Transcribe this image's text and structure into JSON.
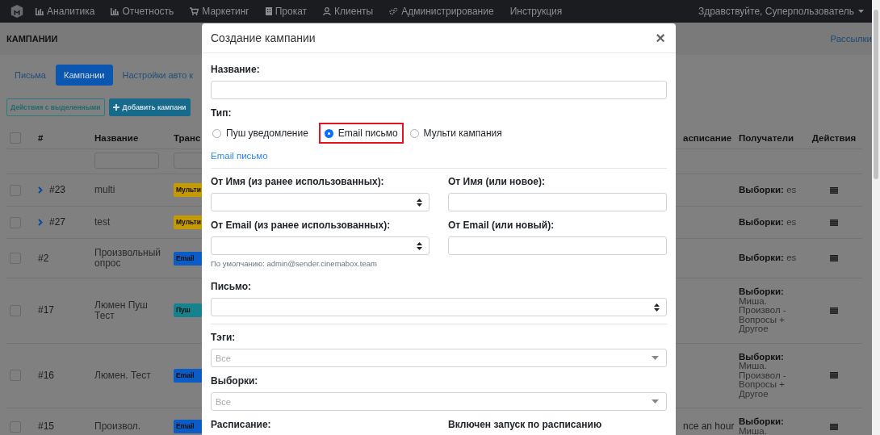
{
  "navbar": {
    "items": [
      {
        "label": "Аналитика"
      },
      {
        "label": "Отчетность"
      },
      {
        "label": "Маркетинг"
      },
      {
        "label": "Прокат"
      },
      {
        "label": "Клиенты"
      },
      {
        "label": "Администрирование"
      },
      {
        "label": "Инструкция"
      }
    ],
    "greeting": "Здравствуйте, Суперпользователь"
  },
  "page_header": {
    "title": "КАМПАНИИ",
    "link": "Рассылки"
  },
  "tabs": [
    {
      "label": "Письма",
      "selected": false
    },
    {
      "label": "Кампании",
      "selected": true
    },
    {
      "label": "Настройки авто к",
      "selected": false
    }
  ],
  "toolbar": {
    "bulk_button": "Действия с выделенными",
    "add_button": "Добавить кампани"
  },
  "table": {
    "header_checked": false,
    "columns": [
      "#",
      "Название",
      "Транс",
      "асписание",
      "Получатели",
      "Действия"
    ],
    "rows": [
      {
        "checked": false,
        "expandable": true,
        "number": "#23",
        "name": "multi",
        "badge": {
          "label": "Мульти",
          "color": "#c49a00"
        },
        "recipients": "**Выборки:** es"
      },
      {
        "checked": false,
        "expandable": true,
        "number": "#27",
        "name": "test",
        "badge": {
          "label": "Мульти",
          "color": "#c49a00"
        },
        "recipients": "**Выборки:** es"
      },
      {
        "checked": false,
        "expandable": false,
        "number": "#2",
        "name": "Произвольный опрос",
        "badge": {
          "label": "Email",
          "color": "#0b5cc4"
        },
        "recipients": "**Выборки:** es"
      },
      {
        "checked": false,
        "expandable": false,
        "number": "#17",
        "name": "Люмен Пуш Тест",
        "badge": {
          "label": "Пуш",
          "color": "#14838e"
        },
        "recipients": "**Выборки:** Миша. Произвол - Вопросы + Другое"
      },
      {
        "checked": false,
        "expandable": false,
        "number": "#16",
        "name": "Люмен. Тест",
        "badge": {
          "label": "Email",
          "color": "#0b5cc4"
        },
        "recipients": "**Выборки:** Миша. Произвол - Вопросы + Другое"
      },
      {
        "checked": false,
        "expandable": false,
        "number": "#15",
        "name": "Произвол.",
        "badge": {
          "label": "Email",
          "color": "#0b5cc4"
        },
        "schedule": "nce an hour",
        "recipients": "**Выборки:** Миша."
      }
    ]
  },
  "modal": {
    "title": "Создание кампании",
    "close": "×",
    "name_field": {
      "label": "Название:"
    },
    "type": {
      "label": "Тип:",
      "options": [
        {
          "label": "Пуш уведомление",
          "selected": false,
          "highlighted": false
        },
        {
          "label": "Email письмо",
          "selected": true,
          "highlighted": true
        },
        {
          "label": "Мульти кампания",
          "selected": false,
          "highlighted": false
        }
      ]
    },
    "type_link": "Email письмо",
    "from_name": {
      "select_label": "От Имя (из ранее использованных):",
      "input_label": "От Имя (или новое):"
    },
    "from_email": {
      "select_label": "От Email (из ранее использованных):",
      "input_label": "От Email (или новый):",
      "hint": "По умолчанию: admin@sender.cinemabox.team"
    },
    "letter": {
      "label": "Письмо:"
    },
    "tags": {
      "label": "Тэги:",
      "placeholder": "Все"
    },
    "segments": {
      "label": "Выборки:",
      "placeholder": "Все"
    },
    "schedule": {
      "label": "Расписание:"
    },
    "schedule_enabled": {
      "label": "Включен запуск по расписанию"
    }
  }
}
